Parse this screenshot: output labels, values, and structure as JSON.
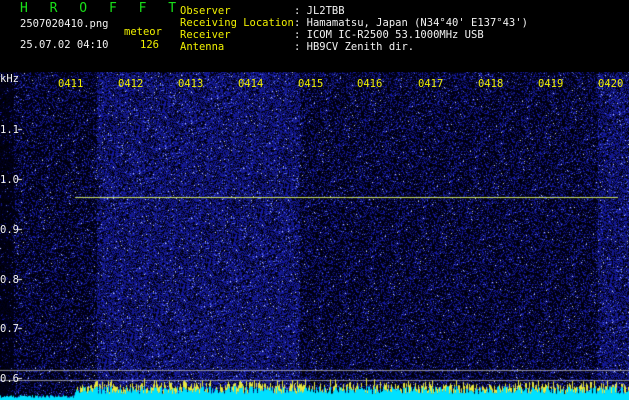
{
  "header": {
    "brand": "H R O F F T",
    "filename": "2507020410.png",
    "mode": "meteor",
    "datetime": "25.07.02 04:10",
    "count": "126",
    "fields": [
      {
        "label": "Observer",
        "value": ": JL2TBB"
      },
      {
        "label": "Receiving Location",
        "value": ": Hamamatsu, Japan (N34°40' E137°43')"
      },
      {
        "label": "Receiver",
        "value": ": ICOM IC-R2500 53.1000MHz USB"
      },
      {
        "label": "Antenna",
        "value": ": HB9CV Zenith dir."
      }
    ]
  },
  "axis": {
    "unit": "kHz",
    "time_ticks": [
      "0411",
      "0412",
      "0413",
      "0414",
      "0415",
      "0416",
      "0417",
      "0418",
      "0419",
      "0420"
    ],
    "freq_ticks": [
      "1.1",
      "1.0",
      "0.9",
      "0.8",
      "0.7",
      "0.6"
    ]
  },
  "colors": {
    "background": "#000000",
    "noise": "#10108a",
    "header_label": "#f0f000",
    "header_value": "#f2f2f2",
    "brand": "#19e019",
    "trace": "#c8e060",
    "baseline": "#00e0ff"
  }
}
